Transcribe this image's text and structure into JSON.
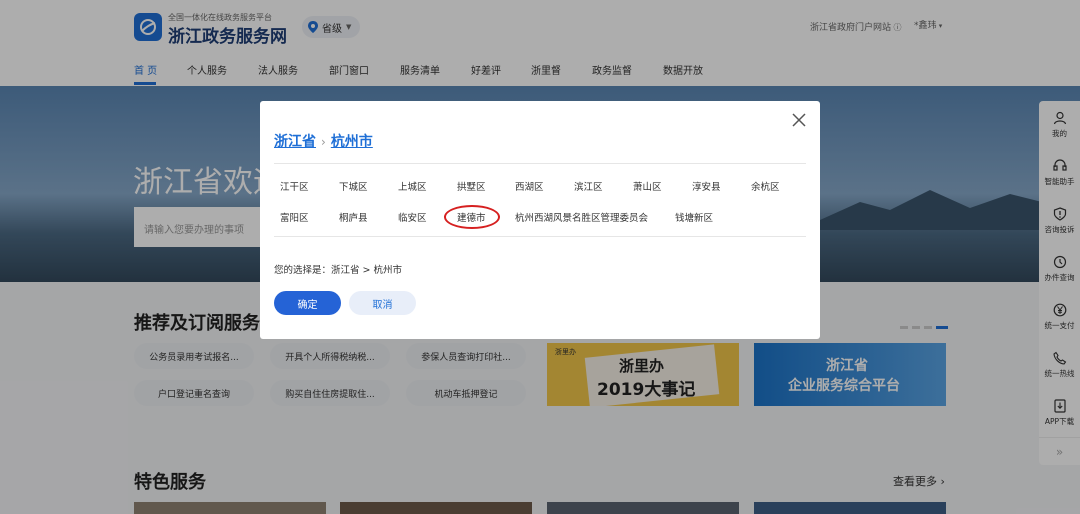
{
  "header": {
    "logo_subtitle": "全国一体化在线政务服务平台",
    "logo_title": "浙江政务服务网",
    "location": "省级",
    "portal_link": "浙江省政府门户网站",
    "user": "*鑫玮"
  },
  "nav": {
    "items": [
      {
        "label": "首 页",
        "active": true
      },
      {
        "label": "个人服务"
      },
      {
        "label": "法人服务"
      },
      {
        "label": "部门窗口"
      },
      {
        "label": "服务清单"
      },
      {
        "label": "好差评"
      },
      {
        "label": "浙里督"
      },
      {
        "label": "政务监督"
      },
      {
        "label": "数据开放"
      }
    ]
  },
  "banner": {
    "title": "浙江省欢迎",
    "search_placeholder": "请输入您要办理的事项"
  },
  "recommend": {
    "title": "推荐及订阅服务",
    "pills": [
      "公务员录用考试报名...",
      "开具个人所得税纳税...",
      "参保人员查询打印社...",
      "户口登记重名查询",
      "购买自住住房提取住...",
      "机动车抵押登记"
    ],
    "promo1_tag": "浙里办",
    "promo1_text1": "浙里办",
    "promo1_text2": "2019大事记",
    "promo2_text1": "浙江省",
    "promo2_text2": "企业服务综合平台"
  },
  "featured": {
    "title": "特色服务",
    "more": "查看更多"
  },
  "sidebar": {
    "items": [
      {
        "label": "我的",
        "icon": "user-icon"
      },
      {
        "label": "智能助手",
        "icon": "headset-icon"
      },
      {
        "label": "咨询投诉",
        "icon": "shield-icon"
      },
      {
        "label": "办件查询",
        "icon": "history-icon"
      },
      {
        "label": "统一支付",
        "icon": "yen-icon"
      },
      {
        "label": "统一热线",
        "icon": "phone-icon"
      },
      {
        "label": "APP下载",
        "icon": "download-icon"
      }
    ]
  },
  "modal": {
    "province": "浙江省",
    "city": "杭州市",
    "districts_row1": [
      "江干区",
      "下城区",
      "上城区",
      "拱墅区",
      "西湖区",
      "滨江区",
      "萧山区",
      "淳安县",
      "余杭区"
    ],
    "districts_row2": [
      "富阳区",
      "桐庐县",
      "临安区",
      "建德市",
      "杭州西湖风景名胜区管理委员会",
      "钱塘新区"
    ],
    "highlighted": "建德市",
    "choice_text": "您的选择是：浙江省 > 杭州市",
    "ok_label": "确定",
    "cancel_label": "取消"
  },
  "colors": {
    "accent": "#1f6fd6",
    "button": "#2563d6",
    "highlight_ring": "#d62020"
  }
}
